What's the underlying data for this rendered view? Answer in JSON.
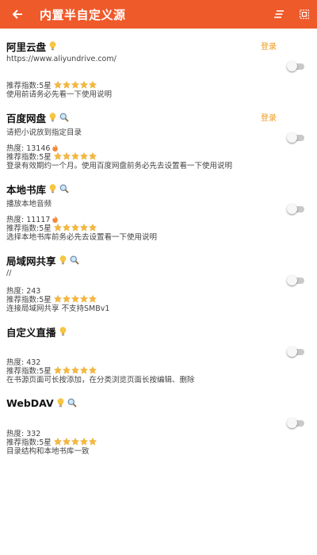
{
  "appbar": {
    "title": "内置半自定义源",
    "back_icon": "back-arrow-icon",
    "sort_icon": "sort-icon",
    "select_icon": "select-all-icon",
    "color": "#ef5a2b"
  },
  "colors": {
    "login": "#ef9a1a",
    "star": "#f5b83d"
  },
  "items": [
    {
      "name": "阿里云盘",
      "icons": [
        "lightbulb-icon"
      ],
      "login": "登录",
      "line1": "https://www.aliyundrive.com/",
      "heat": "",
      "rating_label": "推荐指数:5星",
      "rating": 5,
      "desc": "使用前请务必先看一下使用说明",
      "enabled": false
    },
    {
      "name": "百度网盘",
      "icons": [
        "lightbulb-icon",
        "search-icon"
      ],
      "login": "登录",
      "line1": "请把小说放到指定目录",
      "heat": "热度: 13146",
      "rating_label": "推荐指数:5星",
      "rating": 5,
      "desc": "登录有效期约一个月。使用百度网盘前务必先去设置看一下使用说明",
      "enabled": false
    },
    {
      "name": "本地书库",
      "icons": [
        "lightbulb-icon",
        "search-icon"
      ],
      "login": "",
      "line1": "播放本地音频",
      "heat": "热度: 11117",
      "rating_label": "推荐指数:5星",
      "rating": 5,
      "desc": "选择本地书库前务必先去设置看一下使用说明",
      "enabled": false
    },
    {
      "name": "局域网共享",
      "icons": [
        "lightbulb-icon",
        "search-icon"
      ],
      "login": "",
      "line1": "//",
      "heat": "热度: 243",
      "rating_label": "推荐指数:5星",
      "rating": 5,
      "desc": "连接局域网共享 不支持SMBv1",
      "enabled": false
    },
    {
      "name": "自定义直播",
      "icons": [
        "lightbulb-icon"
      ],
      "login": "",
      "line1": "",
      "heat": "热度: 432",
      "rating_label": "推荐指数:5星",
      "rating": 5,
      "desc": "在书源页面可长按添加，在分类浏览页面长按编辑、删除",
      "enabled": false
    },
    {
      "name": "WebDAV",
      "icons": [
        "lightbulb-icon",
        "search-icon"
      ],
      "login": "",
      "line1": "",
      "heat": "热度: 332",
      "rating_label": "推荐指数:5星",
      "rating": 5,
      "desc": "目录结构和本地书库一致",
      "enabled": false
    }
  ]
}
